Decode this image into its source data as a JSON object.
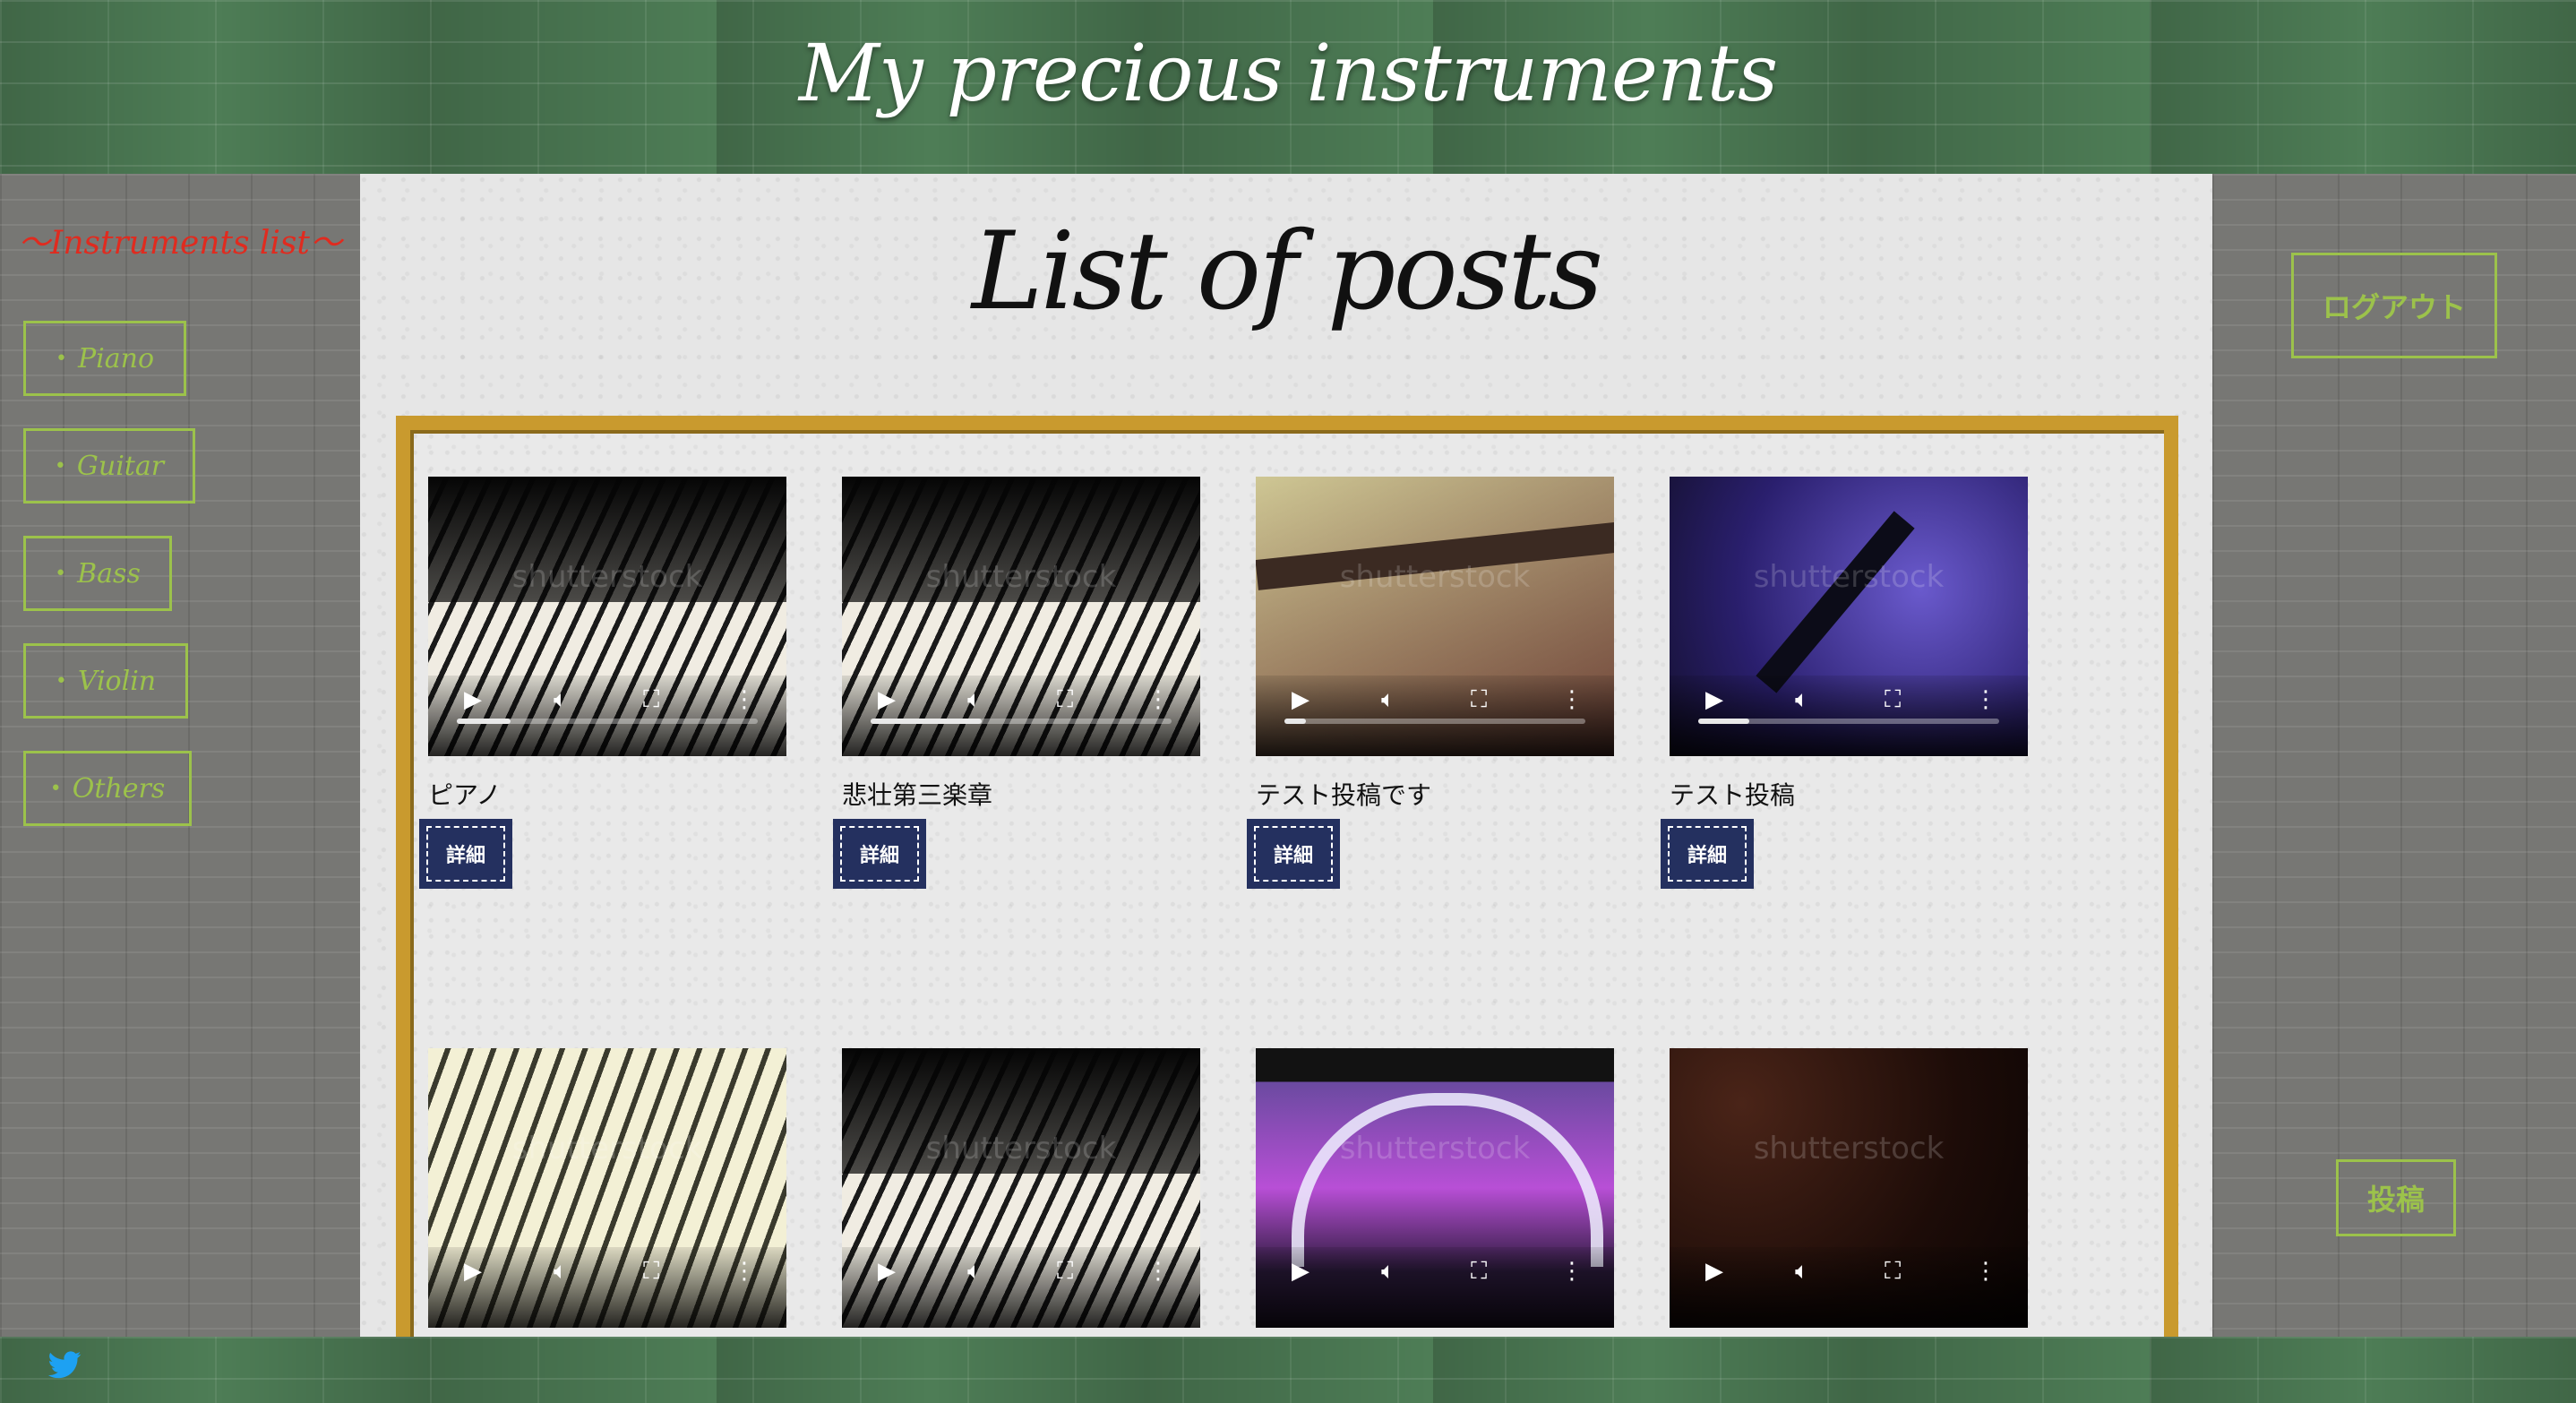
{
  "site": {
    "title": "My precious instruments"
  },
  "sidebar": {
    "heading": "〜Instruments list〜",
    "categories": [
      {
        "label": "Piano"
      },
      {
        "label": "Guitar"
      },
      {
        "label": "Bass"
      },
      {
        "label": "Violin"
      },
      {
        "label": "Others"
      }
    ]
  },
  "actions": {
    "logout_label": "ログアウト",
    "post_label": "投稿"
  },
  "main": {
    "page_title": "List of posts",
    "detail_label": "詳細",
    "watermark": "shutterstock"
  },
  "posts": [
    {
      "title": "ピアノ",
      "scene": "piano",
      "progress": 0.18
    },
    {
      "title": "悲壮第三楽章",
      "scene": "piano",
      "progress": 0.37
    },
    {
      "title": "テスト投稿です",
      "scene": "guitar",
      "progress": 0.07
    },
    {
      "title": "テスト投稿",
      "scene": "bass",
      "progress": 0.17
    },
    {
      "title": "",
      "scene": "keys-light",
      "progress": 0
    },
    {
      "title": "",
      "scene": "piano",
      "progress": 0
    },
    {
      "title": "",
      "scene": "stage",
      "progress": 0
    },
    {
      "title": "",
      "scene": "dark",
      "progress": 0
    }
  ],
  "icons": {
    "footer": "twitter-icon",
    "play": "play-icon",
    "volume": "volume-icon",
    "fullscreen": "fullscreen-icon",
    "more": "more-icon"
  },
  "colors": {
    "accent_green": "#9cc24b",
    "heading_red": "#e02b1f",
    "frame_gold": "#c99a2e",
    "detail_navy": "#24305f",
    "twitter_blue": "#1da1f2"
  }
}
